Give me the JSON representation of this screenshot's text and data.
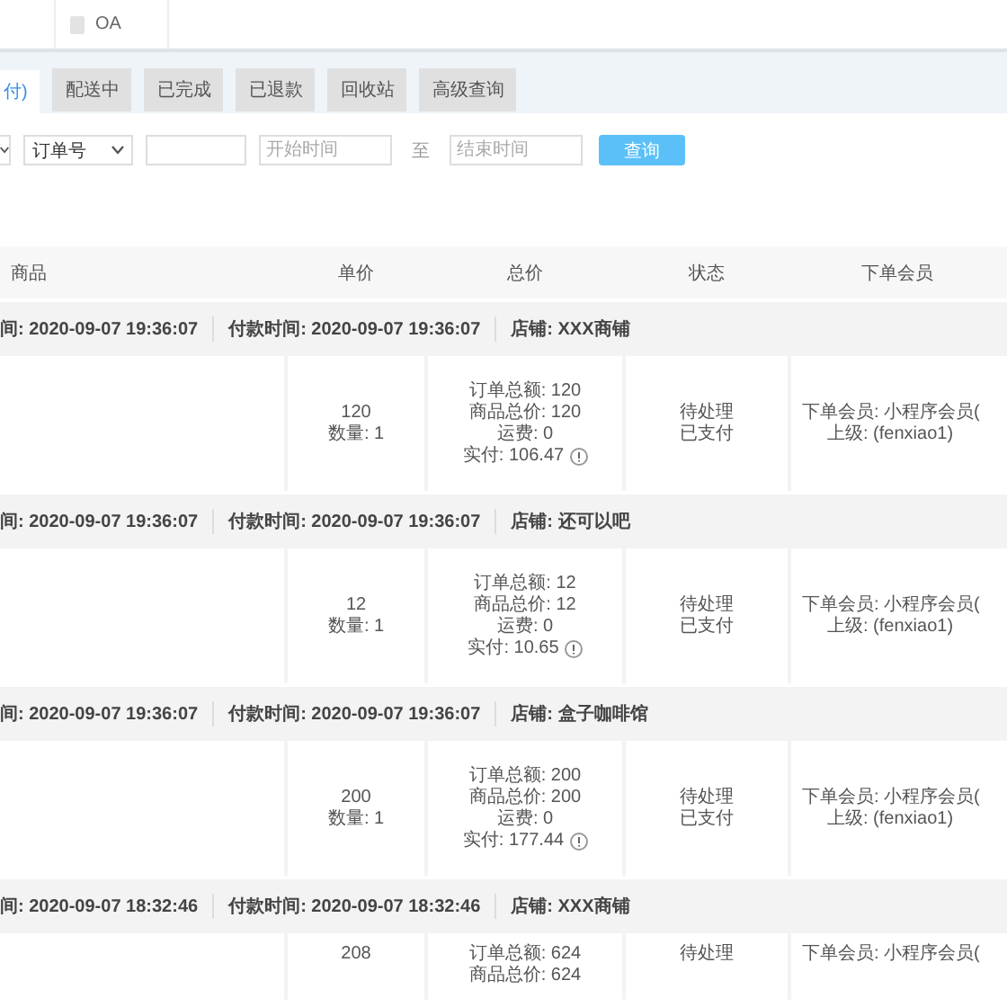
{
  "top_tabs": [
    {
      "label": "OA"
    }
  ],
  "status_tabs": [
    {
      "label": "付)",
      "selected": true
    },
    {
      "label": "配送中",
      "selected": false
    },
    {
      "label": "已完成",
      "selected": false
    },
    {
      "label": "已退款",
      "selected": false
    },
    {
      "label": "回收站",
      "selected": false
    },
    {
      "label": "高级查询",
      "selected": false
    }
  ],
  "filters": {
    "search_by": "订单号",
    "start_placeholder": "开始时间",
    "range_separator": "至",
    "end_placeholder": "结束时间",
    "search_button": "查询"
  },
  "table": {
    "columns": [
      "商品",
      "单价",
      "总价",
      "状态",
      "下单会员"
    ],
    "orders": [
      {
        "created": "间: 2020-09-07 19:36:07",
        "paid": "付款时间: 2020-09-07 19:36:07",
        "store": "店铺: XXX商铺",
        "price": [
          "120",
          "数量: 1"
        ],
        "totals": [
          "订单总额: 120",
          "商品总价: 120",
          "运费: 0"
        ],
        "actual": "实付: 106.47",
        "status": [
          "待处理",
          "已支付"
        ],
        "member": [
          "下单会员: 小程序会员(",
          "上级: (fenxiao1)"
        ]
      },
      {
        "created": "间: 2020-09-07 19:36:07",
        "paid": "付款时间: 2020-09-07 19:36:07",
        "store": "店铺: 还可以吧",
        "price": [
          "12",
          "数量: 1"
        ],
        "totals": [
          "订单总额: 12",
          "商品总价: 12",
          "运费: 0"
        ],
        "actual": "实付: 10.65",
        "status": [
          "待处理",
          "已支付"
        ],
        "member": [
          "下单会员: 小程序会员(",
          "上级: (fenxiao1)"
        ]
      },
      {
        "created": "间: 2020-09-07 19:36:07",
        "paid": "付款时间: 2020-09-07 19:36:07",
        "store": "店铺: 盒子咖啡馆",
        "price": [
          "200",
          "数量: 1"
        ],
        "totals": [
          "订单总额: 200",
          "商品总价: 200",
          "运费: 0"
        ],
        "actual": "实付: 177.44",
        "status": [
          "待处理",
          "已支付"
        ],
        "member": [
          "下单会员: 小程序会员(",
          "上级: (fenxiao1)"
        ]
      },
      {
        "created": "间: 2020-09-07 18:32:46",
        "paid": "付款时间: 2020-09-07 18:32:46",
        "store": "店铺: XXX商铺",
        "price": [
          "208"
        ],
        "totals": [
          "订单总额: 624",
          "商品总价: 624"
        ],
        "status": [
          "待处理"
        ],
        "member": [
          "下单会员: 小程序会员("
        ]
      }
    ]
  }
}
